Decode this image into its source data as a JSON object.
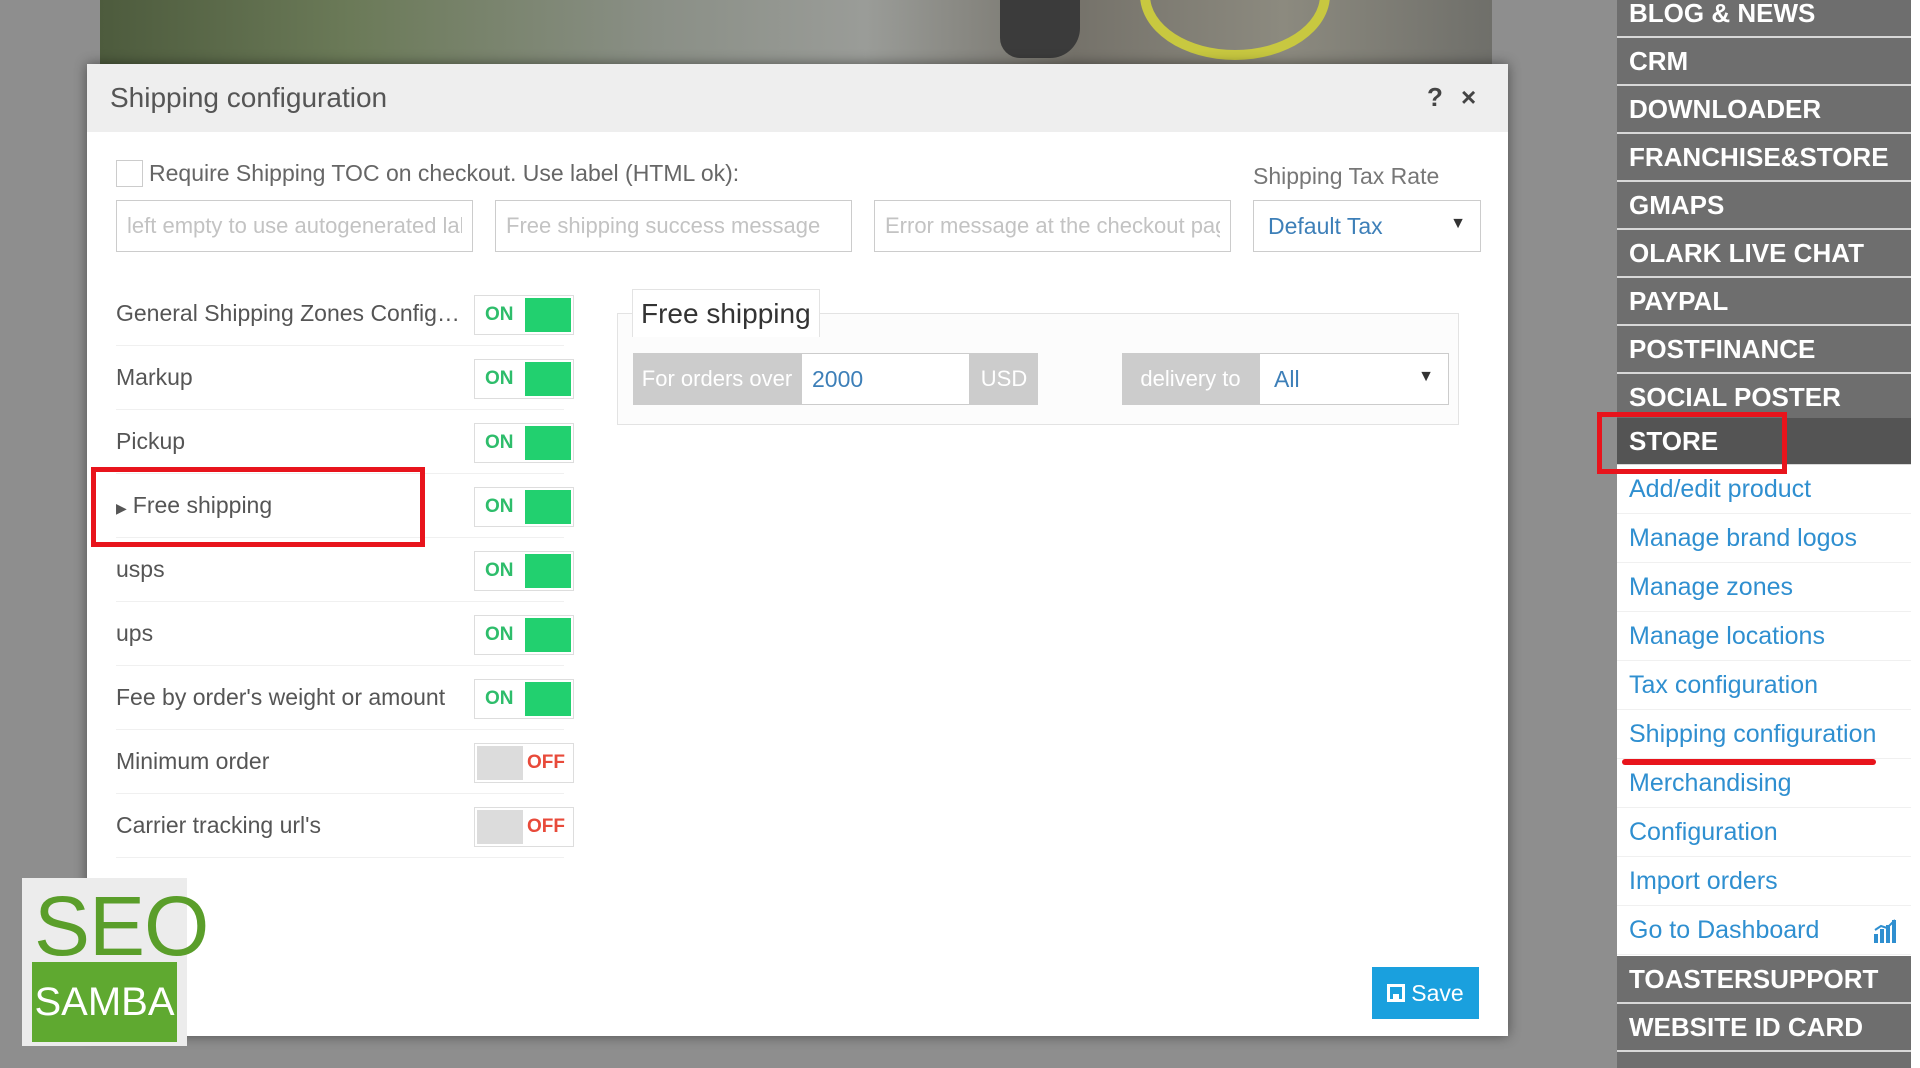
{
  "modal": {
    "title": "Shipping configuration",
    "help_label": "?",
    "close_label": "×"
  },
  "toc": {
    "checkbox_label": "Require Shipping TOC on checkout. Use label (HTML ok):",
    "label_placeholder": "left empty to use autogenerated label",
    "success_placeholder": "Free shipping success message",
    "error_placeholder": "Error message at the checkout page"
  },
  "tax": {
    "label": "Shipping Tax Rate",
    "selected": "Default Tax"
  },
  "toggles": [
    {
      "label": "General Shipping Zones Configuration",
      "state": "ON"
    },
    {
      "label": "Markup",
      "state": "ON"
    },
    {
      "label": "Pickup",
      "state": "ON"
    },
    {
      "label": "Free shipping",
      "state": "ON"
    },
    {
      "label": "usps",
      "state": "ON"
    },
    {
      "label": "ups",
      "state": "ON"
    },
    {
      "label": "Fee by order's weight or amount",
      "state": "ON"
    },
    {
      "label": "Minimum order",
      "state": "OFF"
    },
    {
      "label": "Carrier tracking url's",
      "state": "OFF"
    }
  ],
  "free_shipping": {
    "tab_label": "Free shipping",
    "orders_over_label": "For orders over",
    "amount": "2000",
    "currency": "USD",
    "delivery_label": "delivery to",
    "delivery_selected": "All"
  },
  "save_label": "Save",
  "logo": {
    "top": "SEO",
    "bottom": "SAMBA"
  },
  "sidebar": {
    "top_items": [
      "BLOG & NEWS",
      "CRM",
      "DOWNLOADER",
      "FRANCHISE&STORE",
      "GMAPS",
      "OLARK LIVE CHAT",
      "PAYPAL",
      "POSTFINANCE",
      "SOCIAL POSTER"
    ],
    "active_item": "STORE",
    "sub_items": [
      "Add/edit product",
      "Manage brand logos",
      "Manage zones",
      "Manage locations",
      "Tax configuration",
      "Shipping configuration",
      "Merchandising",
      "Configuration",
      "Import orders",
      "Go to Dashboard"
    ],
    "bottom_items": [
      "TOASTERSUPPORT",
      "WEBSITE ID CARD"
    ]
  },
  "colors": {
    "accent": "#1aa0de",
    "toggle_on": "#22d06f",
    "toggle_off_text": "#e84a3a",
    "highlight": "#e8141c",
    "link": "#2f8fd0"
  }
}
